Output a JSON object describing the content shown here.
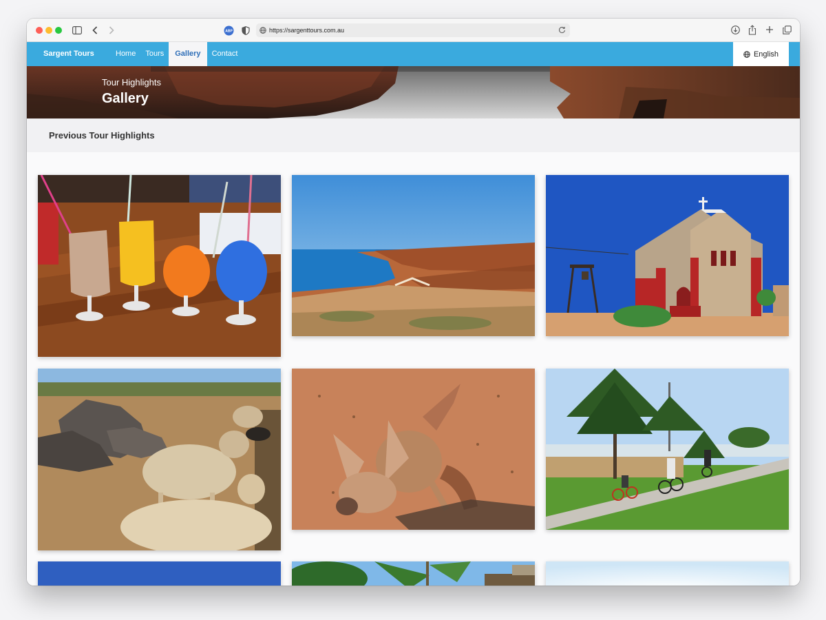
{
  "browser": {
    "url": "https://sargenttours.com.au",
    "extension_label": "ABP"
  },
  "site": {
    "brand": "Sargent Tours",
    "nav": [
      {
        "label": "Home",
        "active": false
      },
      {
        "label": "Tours",
        "active": false
      },
      {
        "label": "Gallery",
        "active": true
      },
      {
        "label": "Contact",
        "active": false
      }
    ],
    "language": "English",
    "accent_color": "#3aaade"
  },
  "hero": {
    "subtitle": "Tour Highlights",
    "title": "Gallery"
  },
  "section": {
    "title": "Previous Tour Highlights"
  },
  "gallery": {
    "photos": [
      {
        "subject": "colourful drinks on wooden table"
      },
      {
        "subject": "coastal cliffs and ocean"
      },
      {
        "subject": "stone church with bell frame"
      },
      {
        "subject": "sheep in a pen"
      },
      {
        "subject": "kangaroo on red sand"
      },
      {
        "subject": "cyclists on path under pine trees"
      },
      {
        "subject": "blue sky"
      },
      {
        "subject": "palm trees"
      },
      {
        "subject": "bright sky"
      }
    ]
  }
}
